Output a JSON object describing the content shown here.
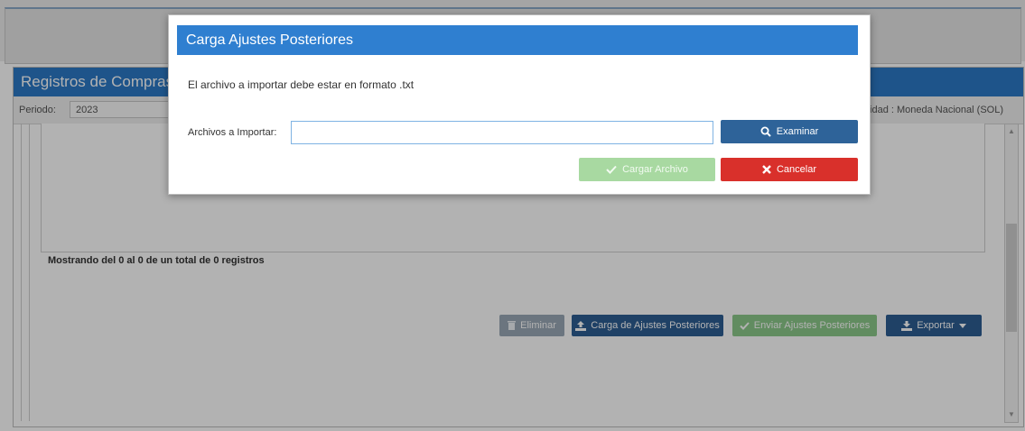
{
  "background": {
    "panel_title": "Registros de Compras",
    "period_label": "Periodo:",
    "period_value": "2023",
    "currency_text": "...ilidad : Moneda Nacional (SOL)",
    "records_text": "Mostrando del 0 al 0 de un total de 0 registros",
    "buttons": {
      "eliminar": "Eliminar",
      "carga_ajustes": "Carga de Ajustes Posteriores",
      "enviar_ajustes": "Enviar Ajustes Posteriores",
      "exportar": "Exportar"
    }
  },
  "modal": {
    "title": "Carga Ajustes Posteriores",
    "message": "El archivo a importar debe estar en formato .txt",
    "file_label": "Archivos a Importar:",
    "file_value": "",
    "examinar_label": "Examinar",
    "cargar_label": "Cargar Archivo",
    "cancelar_label": "Cancelar"
  },
  "colors": {
    "header_blue": "#2f7fd0",
    "button_blue": "#2e6399",
    "button_green_disabled": "#a8d9a1",
    "button_red": "#d9302b"
  }
}
